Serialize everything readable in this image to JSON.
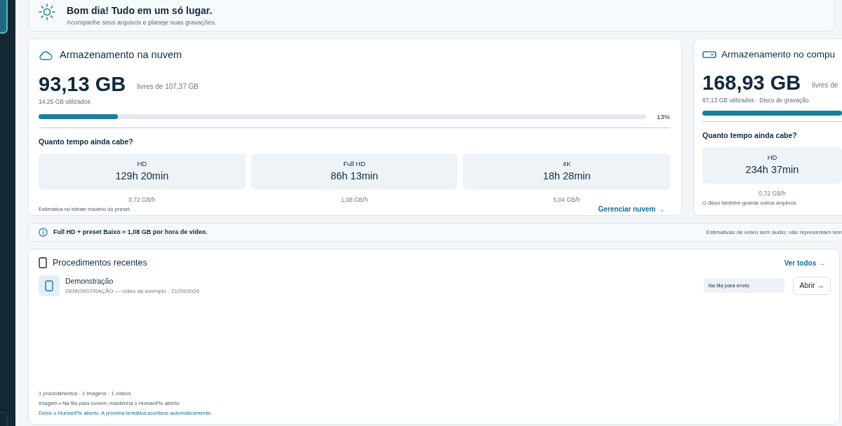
{
  "header": {
    "title": "Bom dia! Tudo em um só lugar.",
    "subtitle": "Acompanhe seus arquivos e planeje suas gravações."
  },
  "storage": [
    {
      "kind": "cloud",
      "title": "Armazenamento na nuvem",
      "free": "93,13 GB",
      "total": "livres de 107,37 GB",
      "used": "14,25 GB utilizados",
      "level": 0.13,
      "percent": "13%",
      "question": "Quanto tempo ainda cabe?",
      "estimates": [
        {
          "label": "HD",
          "time": "129h 20min",
          "rate": "0,72 GB/h"
        },
        {
          "label": "Full HD",
          "time": "86h 13min",
          "rate": "1,08 GB/h"
        },
        {
          "label": "4K",
          "time": "18h 28min",
          "rate": "5,04 GB/h"
        }
      ],
      "note": "Estimativa no bitrate máximo do preset.",
      "link": "Gerenciar nuvem →"
    },
    {
      "kind": "disk",
      "title": "Armazenamento no compu",
      "free": "168,93 GB",
      "total": "livres de",
      "used": "87,13 GB utilizados · Disco de gravação",
      "level": 1,
      "question": "Quanto tempo ainda cabe?",
      "estimates": [
        {
          "label": "HD",
          "time": "234h 37min",
          "rate": "0,72 GB/h"
        }
      ],
      "note": "O disco também guarda outros arquivos."
    }
  ],
  "info": {
    "text": "Full HD + preset Baixo ≈ 1,08 GB por hora de vídeo.",
    "aside": "Estimativas de vídeo sem áudio; não representam tem"
  },
  "recent": {
    "title": "Procedimentos recentes",
    "link": "Ver todos →",
    "items": [
      {
        "name": "Demonstração",
        "meta": "DEMONSTRAÇÃO — vídeo de exemplo · 21/09/2026",
        "status": "Na fila para envio",
        "action": "Abrir →"
      }
    ],
    "footer": [
      {
        "kind": "info",
        "text": "1 procedimentos · 1 imagens · 1 vídeos"
      },
      {
        "kind": "info",
        "text": "Imagem • Na fila para nuvem; mantenha o HumanPix aberto"
      },
      {
        "kind": "hint",
        "text": "Deixe o HumanPix aberto. A próxima tentativa acontece automaticamente."
      }
    ]
  }
}
